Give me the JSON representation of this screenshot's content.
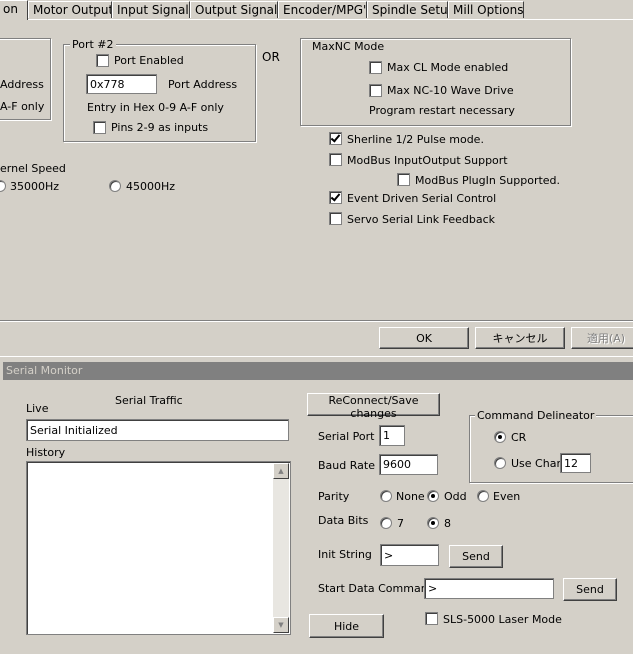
{
  "tabs": [
    "on",
    "Motor Outputs",
    "Input Signals",
    "Output Signals",
    "Encoder/MPG's",
    "Spindle Setup",
    "Mill Options"
  ],
  "port1": {
    "address_fragment": "Address",
    "hex_fragment": "A-F only"
  },
  "port2": {
    "title": "Port #2",
    "enabled_label": "Port Enabled",
    "address_value": "0x778",
    "address_label": "Port Address",
    "hex_note": "Entry in Hex 0-9 A-F only",
    "pins_label": "Pins 2-9 as inputs"
  },
  "or_label": "OR",
  "maxnc": {
    "title": "MaxNC Mode",
    "cl_label": "Max CL Mode enabled",
    "wave_label": "Max NC-10 Wave Drive",
    "restart_note": "Program restart necessary"
  },
  "kernel": {
    "label": "ernel Speed",
    "opt1": "35000Hz",
    "opt2": "45000Hz"
  },
  "options": {
    "sherline": "Sherline 1/2 Pulse mode.",
    "modbus": "ModBus InputOutput Support",
    "plugin": "ModBus PlugIn Supported.",
    "event": "Event Driven Serial Control",
    "servo": "Servo Serial Link Feedback"
  },
  "dialog_buttons": {
    "ok": "OK",
    "cancel": "キャンセル",
    "apply": "適用(A)"
  },
  "serial": {
    "title": "Serial Monitor",
    "traffic_label": "Serial Traffic",
    "live_label": "Live",
    "live_value": "Serial Initialized",
    "history_label": "History",
    "reconnect": "ReConnect/Save changes",
    "port_label": "Serial Port",
    "port_value": "1",
    "baud_label": "Baud Rate",
    "baud_value": "9600",
    "parity_label": "Parity",
    "parity_none": "None",
    "parity_odd": "Odd",
    "parity_even": "Even",
    "databits_label": "Data Bits",
    "bits7": "7",
    "bits8": "8",
    "init_label": "Init String",
    "init_value": ">",
    "send": "Send",
    "start_label": "Start Data Command",
    "start_value": ">",
    "hide": "Hide",
    "laser_label": "SLS-5000 Laser Mode",
    "delim_title": "Command Delineator",
    "cr_label": "CR",
    "usechar_label": "Use Char",
    "usechar_value": "12"
  }
}
